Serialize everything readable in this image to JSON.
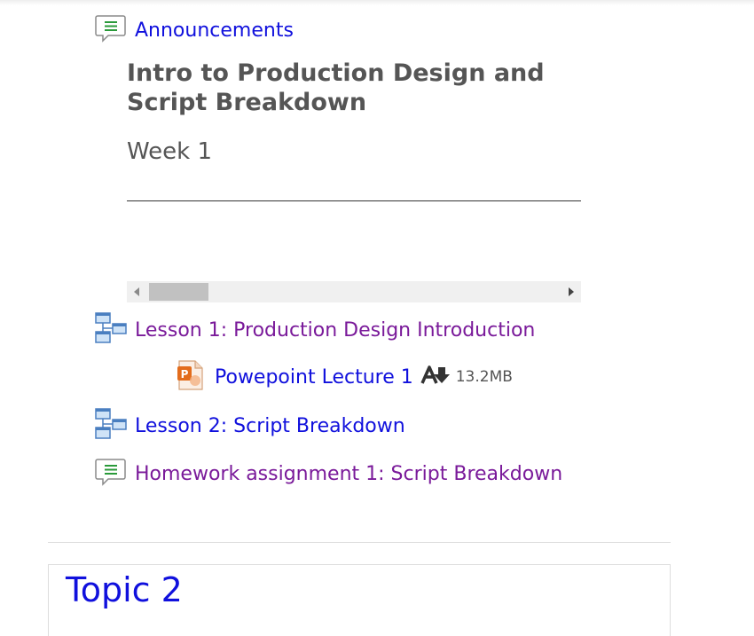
{
  "section": {
    "announcements_label": "Announcements",
    "heading": "Intro to Production Design and Script Breakdown",
    "week": "Week 1"
  },
  "activities": [
    {
      "label": "Lesson 1: Production Design Introduction",
      "icon": "lesson-icon",
      "color": "#7a1a9a"
    },
    {
      "label": "Powepoint Lecture 1",
      "icon": "powerpoint-icon",
      "color": "#1010dd",
      "size": "13.2MB",
      "badge_icon": "download-icon"
    },
    {
      "label": "Lesson 2: Script Breakdown",
      "icon": "lesson-icon",
      "color": "#1010dd"
    },
    {
      "label": "Homework assignment 1: Script Breakdown",
      "icon": "forum-icon",
      "color": "#7a1a9a"
    }
  ],
  "topic": {
    "title": "Topic 2"
  }
}
